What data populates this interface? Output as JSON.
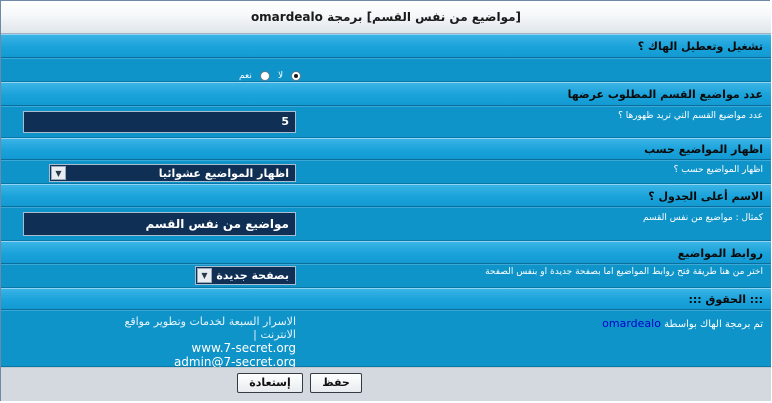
{
  "title": "[مواضيع من نفس القسم] برمجة omardealo",
  "sections": {
    "toggle": {
      "header": "تشغيل وتعطيل الهاك ؟",
      "yes_label": "نعم",
      "no_label": "لا",
      "selected": "yes"
    },
    "count": {
      "header": "عدد مواضيع القسم المطلوب عرضها",
      "question": "عدد مواضيع القسم التي تريد ظهورها ؟",
      "value": "5"
    },
    "display": {
      "header": "اظهار المواضيع حسب",
      "question": "اظهار المواضيع حسب ؟",
      "selected": "اظهار المواضيع عشوائيا"
    },
    "table_name": {
      "header": "الاسم أعلى الجدول ؟",
      "question": "كمثال : مواضيع من نفس القسم",
      "value": "مواضيع من نفس القسم"
    },
    "links": {
      "header": "روابط المواضيع",
      "question": "اختر من هنا طريقة فتح روابط المواضيع اما بصفحة جديدة او بنفس الصفحة",
      "selected": "بصفحة جديدة"
    },
    "rights": {
      "header": "::: الحقوق :::",
      "credit_text": "تم برمجة الهاك بواسطة",
      "credit_link": "omardealo",
      "company_line": "الاسرار السبعة لخدمات وتطوير مواقع الانترنت  |",
      "website": "www.7-secret.org",
      "email": "admin@7-secret.org"
    }
  },
  "buttons": {
    "save": "حفظ",
    "restore": "إستعادة"
  }
}
